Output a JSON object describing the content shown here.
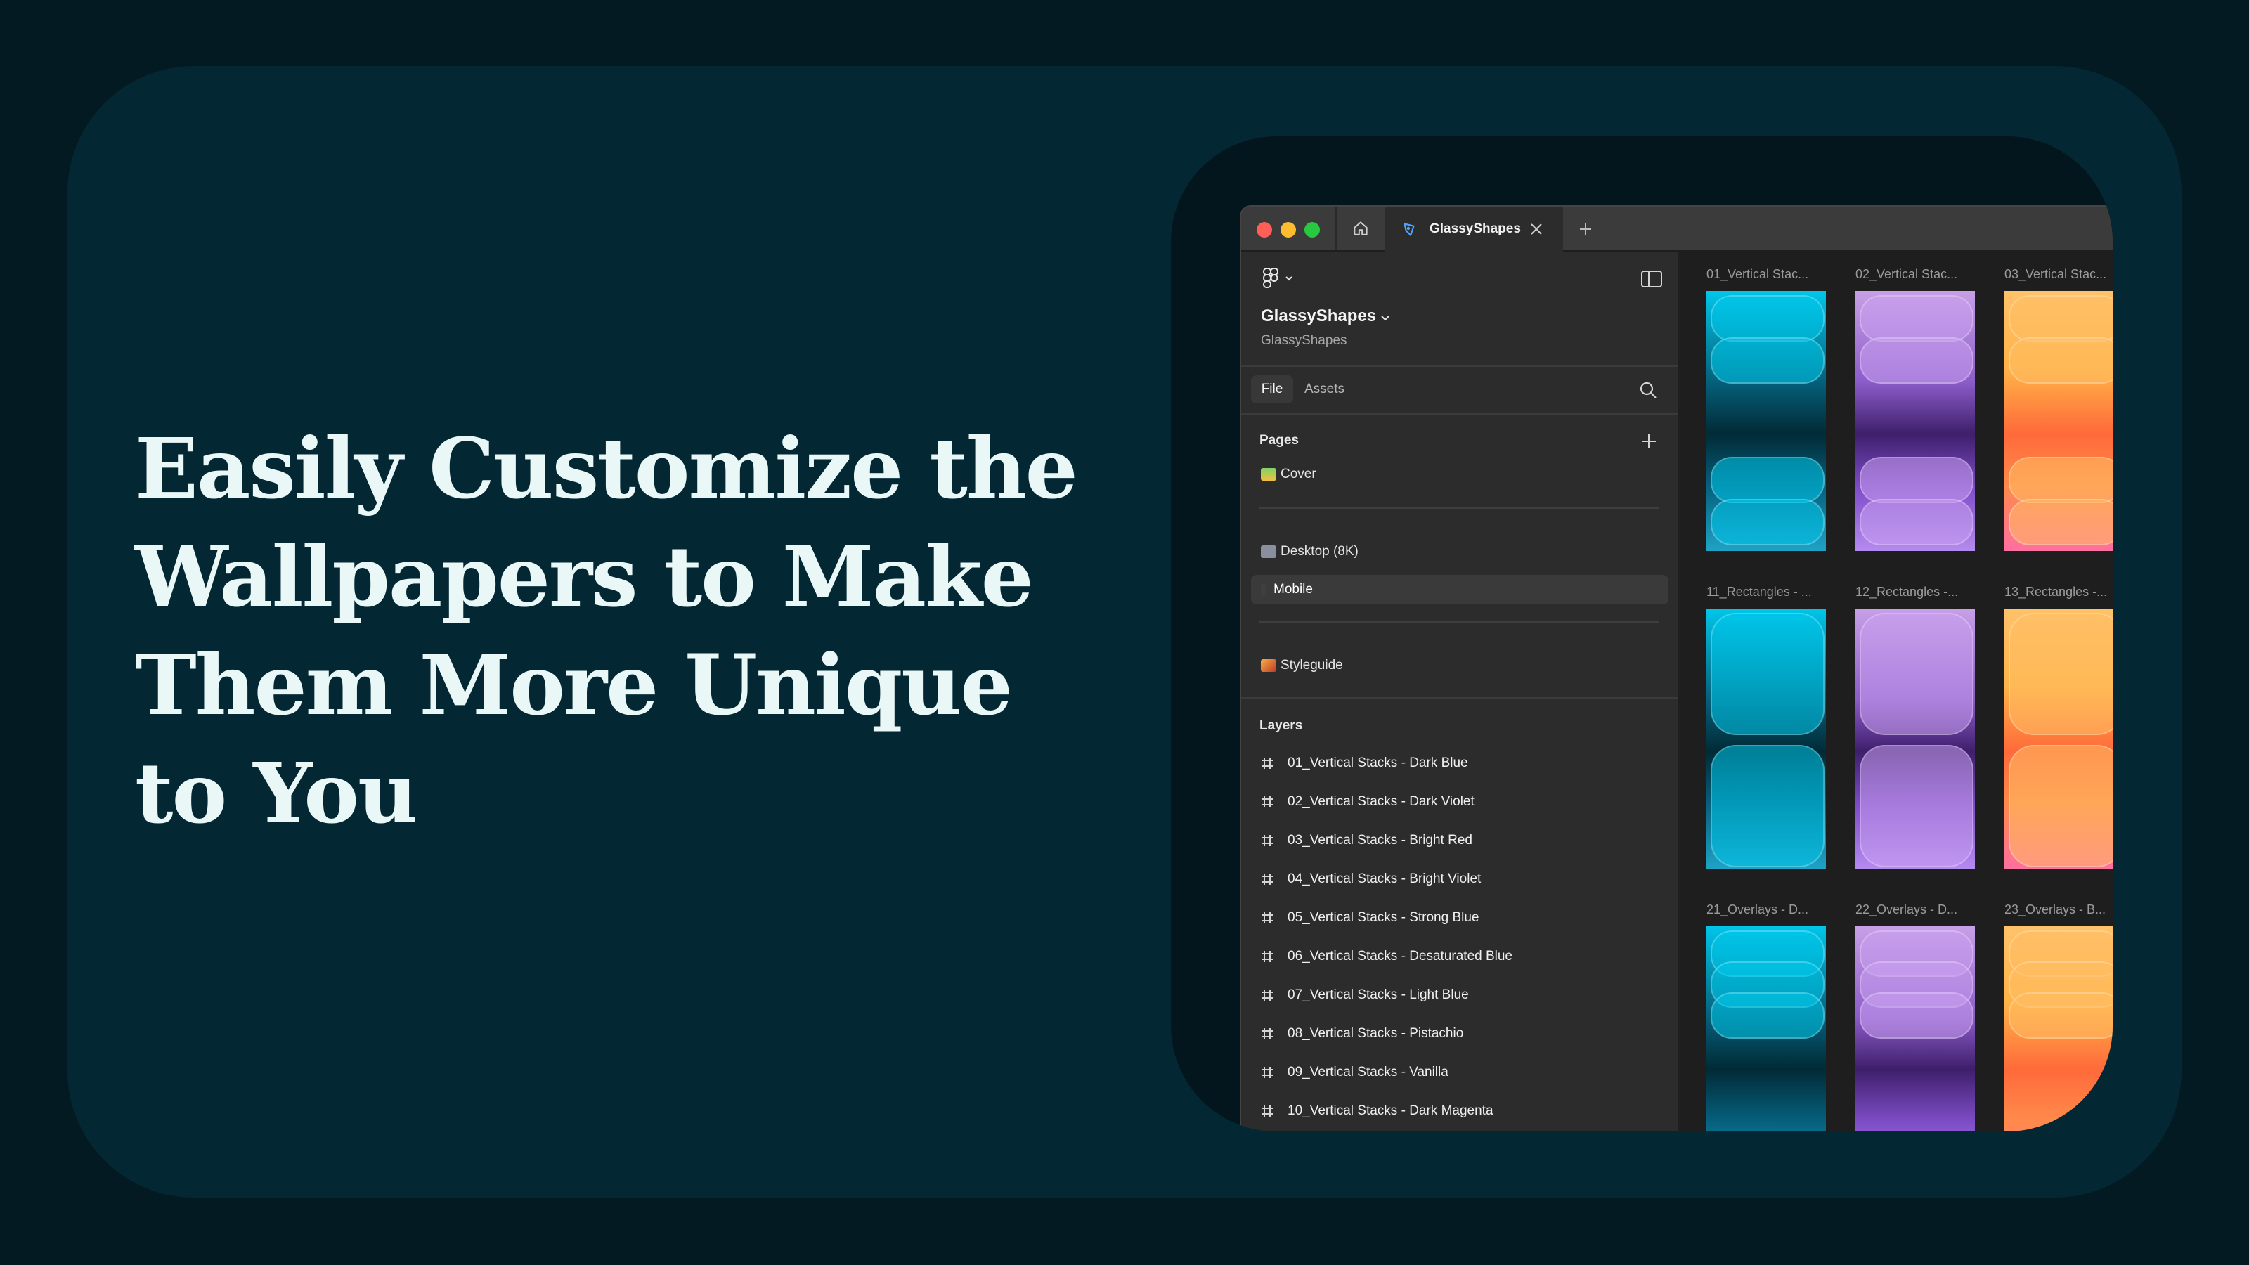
{
  "headline": "Easily Customize the Wallpapers to Make Them More Unique to You",
  "tab": {
    "title": "GlassyShapes"
  },
  "project": {
    "name": "GlassyShapes",
    "subtitle": "GlassyShapes"
  },
  "segments": {
    "file": "File",
    "assets": "Assets"
  },
  "pages": {
    "heading": "Pages",
    "items": [
      "Cover",
      "Desktop (8K)",
      "Mobile",
      "Styleguide"
    ]
  },
  "layers": {
    "heading": "Layers",
    "items": [
      "01_Vertical Stacks - Dark Blue",
      "02_Vertical Stacks - Dark Violet",
      "03_Vertical Stacks - Bright Red",
      "04_Vertical Stacks - Bright Violet",
      "05_Vertical Stacks - Strong Blue",
      "06_Vertical Stacks - Desaturated Blue",
      "07_Vertical Stacks - Light Blue",
      "08_Vertical Stacks - Pistachio",
      "09_Vertical Stacks - Vanilla",
      "10_Vertical Stacks - Dark Magenta"
    ]
  },
  "canvas": {
    "labels": [
      "01_Vertical Stac...",
      "02_Vertical Stac...",
      "03_Vertical Stac...",
      "11_Rectangles - ...",
      "12_Rectangles -...",
      "13_Rectangles -...",
      "21_Overlays - D...",
      "22_Overlays - D...",
      "23_Overlays - B..."
    ]
  },
  "colors": {
    "background": "#031a22",
    "card": "#032834",
    "headline": "#e9f7f6",
    "blue": "#00b7e0",
    "violet": "#a77ae0",
    "orange": "#ffa64d"
  },
  "icons": [
    "home-icon",
    "figma-logo-icon",
    "panel-toggle-icon",
    "search-icon",
    "plus-icon",
    "frame-hash-icon",
    "close-icon"
  ]
}
